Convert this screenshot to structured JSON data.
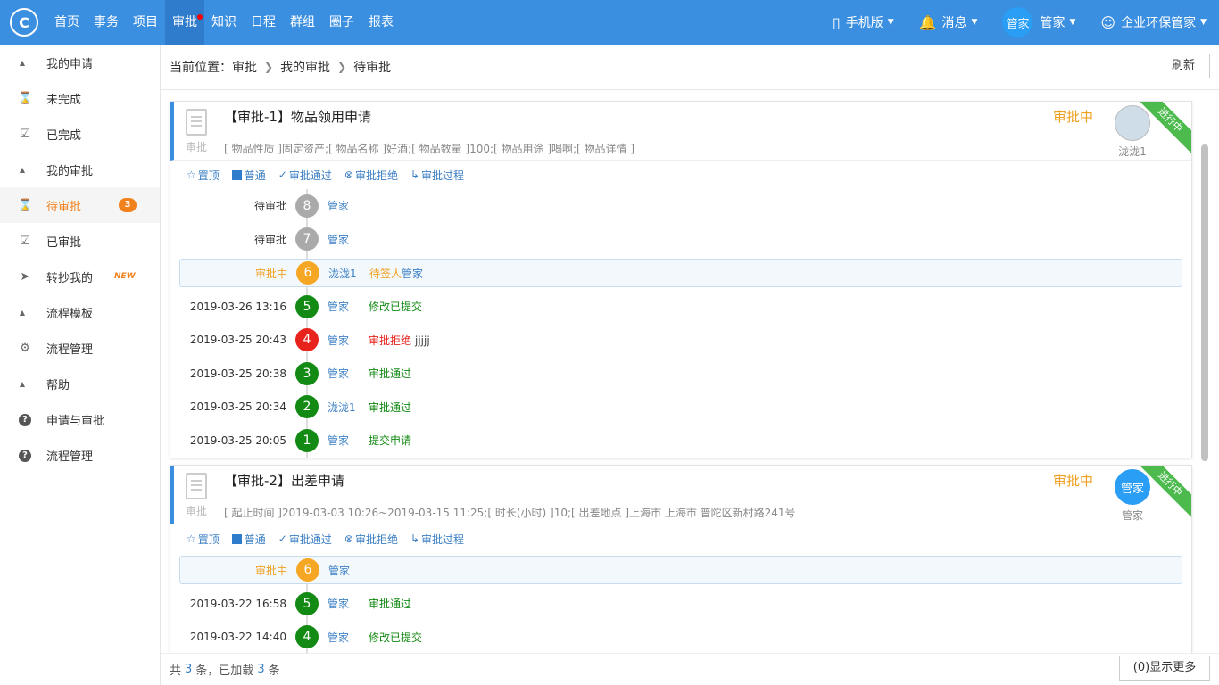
{
  "header": {
    "logo_icon": "logo-icon",
    "nav": [
      "首页",
      "事务",
      "项目",
      "审批",
      "知识",
      "日程",
      "群组",
      "圈子",
      "报表"
    ],
    "active_nav": "审批",
    "mobile": "手机版",
    "messages": "消息",
    "user_avatar": "管家",
    "user_name": "管家",
    "org": "企业环保管家"
  },
  "sidebar": {
    "items": [
      {
        "label": "我的申请",
        "icon": "triangle-up-icon",
        "group": true
      },
      {
        "label": "未完成",
        "icon": "hourglass-icon"
      },
      {
        "label": "已完成",
        "icon": "checkbox-icon"
      },
      {
        "label": "我的审批",
        "icon": "triangle-up-icon",
        "group": true
      },
      {
        "label": "待审批",
        "icon": "hourglass-icon",
        "badge": "3",
        "active": true
      },
      {
        "label": "已审批",
        "icon": "checkbox-icon"
      },
      {
        "label": "转抄我的",
        "icon": "send-icon",
        "tag": "NEW"
      },
      {
        "label": "流程模板",
        "icon": "triangle-up-icon",
        "group": true
      },
      {
        "label": "流程管理",
        "icon": "gear-icon"
      },
      {
        "label": "帮助",
        "icon": "triangle-up-icon",
        "group": true
      },
      {
        "label": "申请与审批",
        "icon": "help-icon"
      },
      {
        "label": "流程管理",
        "icon": "help-icon"
      }
    ]
  },
  "breadcrumb": {
    "prefix": "当前位置：",
    "parts": [
      "审批",
      "我的审批",
      "待审批"
    ]
  },
  "refresh_label": "刷新",
  "card_icon_label": "审批",
  "ribbon_label": "进行中",
  "actions": {
    "pin": "置顶",
    "normal": "普通",
    "approve": "审批通过",
    "reject": "审批拒绝",
    "process": "审批过程"
  },
  "cards": [
    {
      "title": "【审批-1】物品领用申请",
      "desc": "[ 物品性质 ]固定资产;[ 物品名称 ]好酒;[ 物品数量 ]100;[ 物品用途 ]喝啊;[ 物品详情 ]",
      "status": "审批中",
      "user": "泷泷1",
      "timeline": [
        {
          "time": "待审批",
          "step": "8",
          "color": "gray",
          "user": "管家",
          "action": ""
        },
        {
          "time": "待审批",
          "step": "7",
          "color": "gray",
          "user": "管家",
          "action": ""
        },
        {
          "time": "审批中",
          "step": "6",
          "color": "orange",
          "user": "泷泷1",
          "action": "待签人",
          "action2": "管家",
          "current": true
        },
        {
          "time": "2019-03-26 13:16",
          "step": "5",
          "color": "green",
          "user": "管家",
          "action": "修改已提交",
          "ac": "green"
        },
        {
          "time": "2019-03-25 20:43",
          "step": "4",
          "color": "red",
          "user": "管家",
          "action": "审批拒绝",
          "ac": "red",
          "comment": "jjjjj"
        },
        {
          "time": "2019-03-25 20:38",
          "step": "3",
          "color": "green",
          "user": "管家",
          "action": "审批通过",
          "ac": "green"
        },
        {
          "time": "2019-03-25 20:34",
          "step": "2",
          "color": "green",
          "user": "泷泷1",
          "action": "审批通过",
          "ac": "green"
        },
        {
          "time": "2019-03-25 20:05",
          "step": "1",
          "color": "green",
          "user": "管家",
          "action": "提交申请",
          "ac": "green"
        }
      ]
    },
    {
      "title": "【审批-2】出差申请",
      "desc": "[ 起止时间 ]2019-03-03 10:26~2019-03-15 11:25;[ 时长(小时) ]10;[ 出差地点 ]上海市 上海市 普陀区新村路241号",
      "status": "审批中",
      "user": "管家",
      "user_avatar": "管家",
      "timeline": [
        {
          "time": "审批中",
          "step": "6",
          "color": "orange",
          "user": "管家",
          "action": "",
          "current": true
        },
        {
          "time": "2019-03-22 16:58",
          "step": "5",
          "color": "green",
          "user": "管家",
          "action": "审批通过",
          "ac": "green"
        },
        {
          "time": "2019-03-22 14:40",
          "step": "4",
          "color": "green",
          "user": "管家",
          "action": "修改已提交",
          "ac": "green"
        }
      ]
    }
  ],
  "footer": {
    "prefix": "共",
    "total": "3",
    "mid": "条，已加载",
    "loaded": "3",
    "suffix": "条",
    "more": "(0)显示更多"
  }
}
